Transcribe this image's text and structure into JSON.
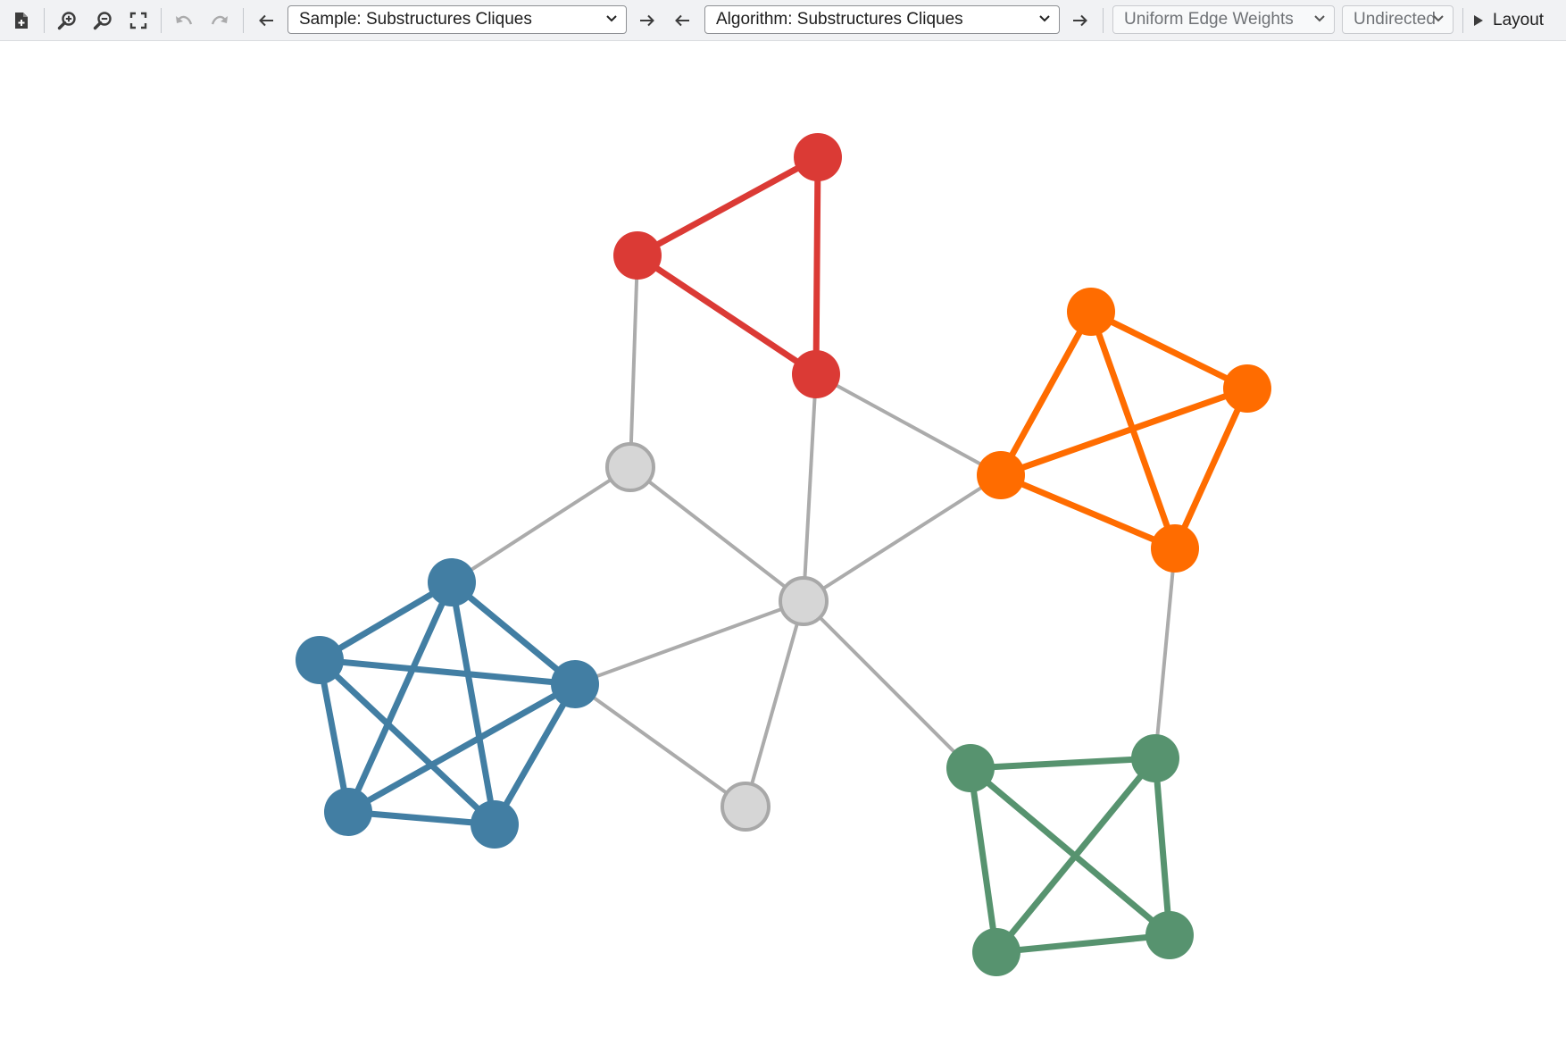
{
  "toolbar": {
    "buttons": [
      {
        "icon": "new-document-icon",
        "enabled": true
      },
      {
        "icon": "zoom-in-icon",
        "enabled": true
      },
      {
        "icon": "zoom-out-icon",
        "enabled": true
      },
      {
        "icon": "fit-screen-icon",
        "enabled": true
      },
      {
        "icon": "undo-icon",
        "enabled": false
      },
      {
        "icon": "redo-icon",
        "enabled": false
      }
    ],
    "sample_select": {
      "value": "Sample: Substructures Cliques"
    },
    "algorithm_select": {
      "value": "Algorithm: Substructures Cliques"
    },
    "edge_weights_select": {
      "value": "Uniform Edge Weights"
    },
    "direction_select": {
      "value": "Undirected"
    },
    "layout_button": {
      "label": "Layout"
    }
  },
  "graph": {
    "colors": {
      "red": "#db3a35",
      "orange": "#ff6c00",
      "blue": "#427ea3",
      "green": "#57936f",
      "neutral_fill": "#d6d6d6",
      "neutral_stroke": "#a8a8a8",
      "neutral_edge": "#ababab"
    },
    "nodes": [
      {
        "id": "r1",
        "group": "red"
      },
      {
        "id": "r2",
        "group": "red"
      },
      {
        "id": "r3",
        "group": "red"
      },
      {
        "id": "o1",
        "group": "orange"
      },
      {
        "id": "o2",
        "group": "orange"
      },
      {
        "id": "o3",
        "group": "orange"
      },
      {
        "id": "o4",
        "group": "orange"
      },
      {
        "id": "b1",
        "group": "blue"
      },
      {
        "id": "b2",
        "group": "blue"
      },
      {
        "id": "b3",
        "group": "blue"
      },
      {
        "id": "b4",
        "group": "blue"
      },
      {
        "id": "b5",
        "group": "blue"
      },
      {
        "id": "g1",
        "group": "green"
      },
      {
        "id": "g2",
        "group": "green"
      },
      {
        "id": "g3",
        "group": "green"
      },
      {
        "id": "g4",
        "group": "green"
      },
      {
        "id": "n1",
        "group": "none"
      },
      {
        "id": "n2",
        "group": "none"
      },
      {
        "id": "n3",
        "group": "none"
      }
    ],
    "edges": [
      {
        "a": "r1",
        "b": "r2"
      },
      {
        "a": "r1",
        "b": "r3"
      },
      {
        "a": "r2",
        "b": "r3"
      },
      {
        "a": "o1",
        "b": "o2"
      },
      {
        "a": "o1",
        "b": "o3"
      },
      {
        "a": "o1",
        "b": "o4"
      },
      {
        "a": "o2",
        "b": "o3"
      },
      {
        "a": "o2",
        "b": "o4"
      },
      {
        "a": "o3",
        "b": "o4"
      },
      {
        "a": "b1",
        "b": "b2"
      },
      {
        "a": "b1",
        "b": "b3"
      },
      {
        "a": "b1",
        "b": "b4"
      },
      {
        "a": "b1",
        "b": "b5"
      },
      {
        "a": "b2",
        "b": "b3"
      },
      {
        "a": "b2",
        "b": "b4"
      },
      {
        "a": "b2",
        "b": "b5"
      },
      {
        "a": "b3",
        "b": "b4"
      },
      {
        "a": "b3",
        "b": "b5"
      },
      {
        "a": "b4",
        "b": "b5"
      },
      {
        "a": "g1",
        "b": "g2"
      },
      {
        "a": "g1",
        "b": "g3"
      },
      {
        "a": "g1",
        "b": "g4"
      },
      {
        "a": "g2",
        "b": "g3"
      },
      {
        "a": "g2",
        "b": "g4"
      },
      {
        "a": "g3",
        "b": "g4"
      },
      {
        "a": "r2",
        "b": "n1"
      },
      {
        "a": "r3",
        "b": "n2"
      },
      {
        "a": "r3",
        "b": "o3"
      },
      {
        "a": "n1",
        "b": "b1"
      },
      {
        "a": "n1",
        "b": "n2"
      },
      {
        "a": "n2",
        "b": "o3"
      },
      {
        "a": "n2",
        "b": "b3"
      },
      {
        "a": "n2",
        "b": "n3"
      },
      {
        "a": "n2",
        "b": "g1"
      },
      {
        "a": "b3",
        "b": "n3"
      },
      {
        "a": "o4",
        "b": "g2"
      }
    ]
  }
}
